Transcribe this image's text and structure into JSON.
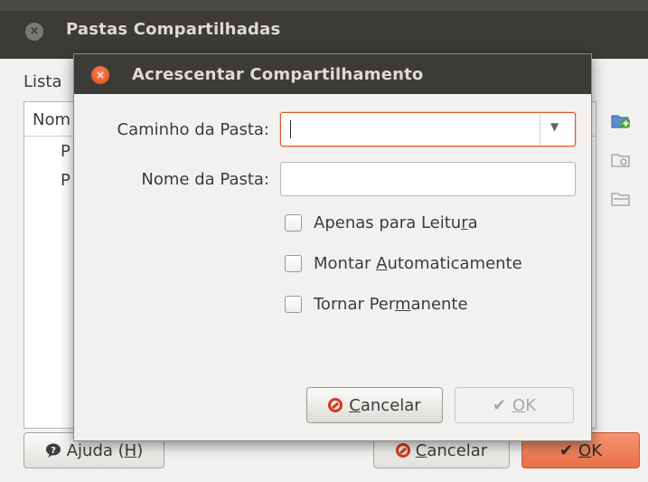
{
  "parent": {
    "title": "Pastas Compartilhadas",
    "close_glyph": "×",
    "list_label": "Lista",
    "list_header": "Nom",
    "list_items": [
      "P",
      "P"
    ],
    "side_icons": [
      "add-folder-icon",
      "edit-folder-icon",
      "remove-folder-icon"
    ],
    "help_button": {
      "prefix": "Ajuda (",
      "mnemonic": "H",
      "suffix": ")"
    },
    "cancel_button": {
      "mnemonic": "C",
      "rest": "ancelar"
    },
    "ok_button": {
      "mnemonic": "O",
      "rest": "K"
    }
  },
  "dialog": {
    "title": "Acrescentar Compartilhamento",
    "close_glyph": "×",
    "path_label": "Caminho da Pasta:",
    "path_value": "",
    "name_label": "Nome da Pasta:",
    "name_value": "",
    "checkboxes": [
      {
        "before": "Apenas para Leitu",
        "mnemonic": "r",
        "after": "a",
        "checked": false
      },
      {
        "before": "Montar ",
        "mnemonic": "A",
        "after": "utomaticamente",
        "checked": false
      },
      {
        "before": "Tornar Per",
        "mnemonic": "m",
        "after": "anente",
        "checked": false
      }
    ],
    "cancel_button": {
      "mnemonic": "C",
      "rest": "ancelar"
    },
    "ok_button": {
      "mnemonic": "O",
      "rest": "K",
      "enabled": false
    }
  },
  "colors": {
    "titlebar": "#3c3b37",
    "accent_orange": "#e0582c",
    "window_bg": "#f2f1f0"
  }
}
